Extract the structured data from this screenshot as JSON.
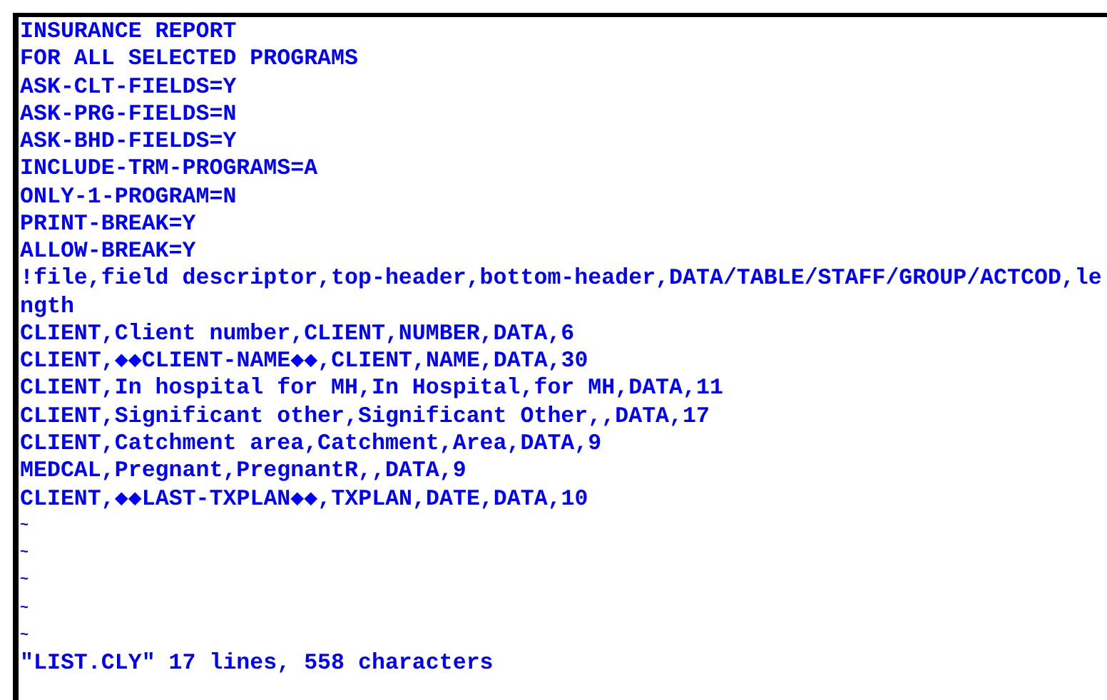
{
  "editor": {
    "lines": [
      "INSURANCE REPORT",
      "FOR ALL SELECTED PROGRAMS",
      "ASK-CLT-FIELDS=Y",
      "ASK-PRG-FIELDS=N",
      "ASK-BHD-FIELDS=Y",
      "INCLUDE-TRM-PROGRAMS=A",
      "ONLY-1-PROGRAM=N",
      "PRINT-BREAK=Y",
      "ALLOW-BREAK=Y",
      "!file,field descriptor,top-header,bottom-header,DATA/TABLE/STAFF/GROUP/ACTCOD,le",
      "ngth",
      "CLIENT,Client number,CLIENT,NUMBER,DATA,6",
      "CLIENT,◆◆CLIENT-NAME◆◆,CLIENT,NAME,DATA,30",
      "CLIENT,In hospital for MH,In Hospital,for MH,DATA,11",
      "CLIENT,Significant other,Significant Other,,DATA,17",
      "CLIENT,Catchment area,Catchment,Area,DATA,9",
      "MEDCAL,Pregnant,PregnantR,,DATA,9",
      "CLIENT,◆◆LAST-TXPLAN◆◆,TXPLAN,DATE,DATA,10"
    ],
    "empty_lines": [
      "~",
      "~",
      "~",
      "~",
      "~"
    ],
    "status_line": "\"LIST.CLY\" 17 lines, 558 characters"
  }
}
